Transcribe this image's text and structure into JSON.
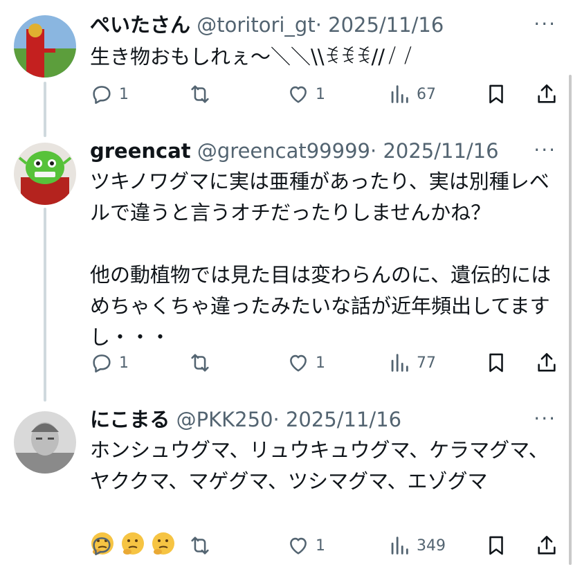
{
  "tweets": [
    {
      "display_name": "ぺいたさん",
      "handle": "@toritori_gt",
      "separator": "·",
      "date": "2025/11/16",
      "more_label": "···",
      "text": "生き物おもしれぇ〜＼＼\\\\ꉂꉂꉂ//／／",
      "replies": "1",
      "reposts": "",
      "likes": "1",
      "views": "67"
    },
    {
      "display_name": "greencat",
      "handle": "@greencat99999",
      "separator": "·",
      "date": "2025/11/16",
      "more_label": "···",
      "text": "ツキノワグマに実は亜種があったり、実は別種レベルで違うと言うオチだったりしませんかね？\n\n他の動植物では見た目は変わらんのに、遺伝的にはめちゃくちゃ違ったみたいな話が近年頻出してますし・・・",
      "replies": "1",
      "reposts": "",
      "likes": "1",
      "views": "77"
    },
    {
      "display_name": "にこまる",
      "handle": "@PKK250",
      "separator": "·",
      "date": "2025/11/16",
      "more_label": "···",
      "text": "ホンシュウグマ、リュウキュウグマ、ケラマグマ、ヤククマ、マゲグマ、ツシマグマ、エゾグマ",
      "emoji": "thinking-face",
      "emoji_count": 3,
      "replies": "",
      "reposts": "",
      "likes": "1",
      "views": "349"
    }
  ],
  "colors": {
    "text": "#0f1419",
    "secondary": "#536471",
    "thread_line": "#cfd9de"
  },
  "icons": [
    "reply-icon",
    "repost-icon",
    "like-icon",
    "views-icon",
    "bookmark-icon",
    "share-icon",
    "more-icon"
  ]
}
